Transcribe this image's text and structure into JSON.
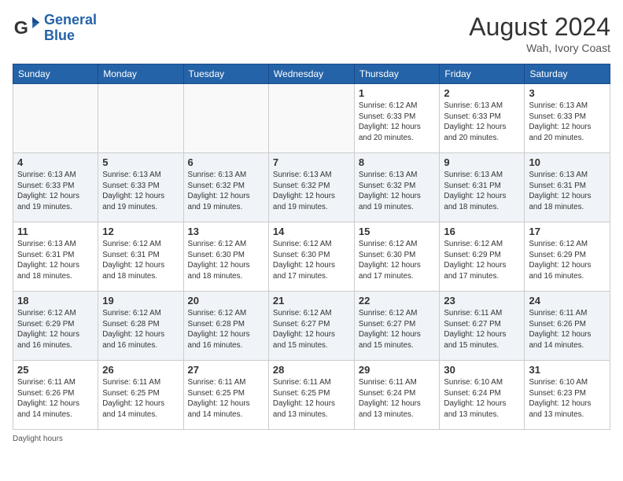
{
  "header": {
    "logo_line1": "General",
    "logo_line2": "Blue",
    "month_year": "August 2024",
    "location": "Wah, Ivory Coast"
  },
  "days_of_week": [
    "Sunday",
    "Monday",
    "Tuesday",
    "Wednesday",
    "Thursday",
    "Friday",
    "Saturday"
  ],
  "weeks": [
    [
      {
        "day": "",
        "info": ""
      },
      {
        "day": "",
        "info": ""
      },
      {
        "day": "",
        "info": ""
      },
      {
        "day": "",
        "info": ""
      },
      {
        "day": "1",
        "info": "Sunrise: 6:12 AM\nSunset: 6:33 PM\nDaylight: 12 hours\nand 20 minutes."
      },
      {
        "day": "2",
        "info": "Sunrise: 6:13 AM\nSunset: 6:33 PM\nDaylight: 12 hours\nand 20 minutes."
      },
      {
        "day": "3",
        "info": "Sunrise: 6:13 AM\nSunset: 6:33 PM\nDaylight: 12 hours\nand 20 minutes."
      }
    ],
    [
      {
        "day": "4",
        "info": "Sunrise: 6:13 AM\nSunset: 6:33 PM\nDaylight: 12 hours\nand 19 minutes."
      },
      {
        "day": "5",
        "info": "Sunrise: 6:13 AM\nSunset: 6:33 PM\nDaylight: 12 hours\nand 19 minutes."
      },
      {
        "day": "6",
        "info": "Sunrise: 6:13 AM\nSunset: 6:32 PM\nDaylight: 12 hours\nand 19 minutes."
      },
      {
        "day": "7",
        "info": "Sunrise: 6:13 AM\nSunset: 6:32 PM\nDaylight: 12 hours\nand 19 minutes."
      },
      {
        "day": "8",
        "info": "Sunrise: 6:13 AM\nSunset: 6:32 PM\nDaylight: 12 hours\nand 19 minutes."
      },
      {
        "day": "9",
        "info": "Sunrise: 6:13 AM\nSunset: 6:31 PM\nDaylight: 12 hours\nand 18 minutes."
      },
      {
        "day": "10",
        "info": "Sunrise: 6:13 AM\nSunset: 6:31 PM\nDaylight: 12 hours\nand 18 minutes."
      }
    ],
    [
      {
        "day": "11",
        "info": "Sunrise: 6:13 AM\nSunset: 6:31 PM\nDaylight: 12 hours\nand 18 minutes."
      },
      {
        "day": "12",
        "info": "Sunrise: 6:12 AM\nSunset: 6:31 PM\nDaylight: 12 hours\nand 18 minutes."
      },
      {
        "day": "13",
        "info": "Sunrise: 6:12 AM\nSunset: 6:30 PM\nDaylight: 12 hours\nand 18 minutes."
      },
      {
        "day": "14",
        "info": "Sunrise: 6:12 AM\nSunset: 6:30 PM\nDaylight: 12 hours\nand 17 minutes."
      },
      {
        "day": "15",
        "info": "Sunrise: 6:12 AM\nSunset: 6:30 PM\nDaylight: 12 hours\nand 17 minutes."
      },
      {
        "day": "16",
        "info": "Sunrise: 6:12 AM\nSunset: 6:29 PM\nDaylight: 12 hours\nand 17 minutes."
      },
      {
        "day": "17",
        "info": "Sunrise: 6:12 AM\nSunset: 6:29 PM\nDaylight: 12 hours\nand 16 minutes."
      }
    ],
    [
      {
        "day": "18",
        "info": "Sunrise: 6:12 AM\nSunset: 6:29 PM\nDaylight: 12 hours\nand 16 minutes."
      },
      {
        "day": "19",
        "info": "Sunrise: 6:12 AM\nSunset: 6:28 PM\nDaylight: 12 hours\nand 16 minutes."
      },
      {
        "day": "20",
        "info": "Sunrise: 6:12 AM\nSunset: 6:28 PM\nDaylight: 12 hours\nand 16 minutes."
      },
      {
        "day": "21",
        "info": "Sunrise: 6:12 AM\nSunset: 6:27 PM\nDaylight: 12 hours\nand 15 minutes."
      },
      {
        "day": "22",
        "info": "Sunrise: 6:12 AM\nSunset: 6:27 PM\nDaylight: 12 hours\nand 15 minutes."
      },
      {
        "day": "23",
        "info": "Sunrise: 6:11 AM\nSunset: 6:27 PM\nDaylight: 12 hours\nand 15 minutes."
      },
      {
        "day": "24",
        "info": "Sunrise: 6:11 AM\nSunset: 6:26 PM\nDaylight: 12 hours\nand 14 minutes."
      }
    ],
    [
      {
        "day": "25",
        "info": "Sunrise: 6:11 AM\nSunset: 6:26 PM\nDaylight: 12 hours\nand 14 minutes."
      },
      {
        "day": "26",
        "info": "Sunrise: 6:11 AM\nSunset: 6:25 PM\nDaylight: 12 hours\nand 14 minutes."
      },
      {
        "day": "27",
        "info": "Sunrise: 6:11 AM\nSunset: 6:25 PM\nDaylight: 12 hours\nand 14 minutes."
      },
      {
        "day": "28",
        "info": "Sunrise: 6:11 AM\nSunset: 6:25 PM\nDaylight: 12 hours\nand 13 minutes."
      },
      {
        "day": "29",
        "info": "Sunrise: 6:11 AM\nSunset: 6:24 PM\nDaylight: 12 hours\nand 13 minutes."
      },
      {
        "day": "30",
        "info": "Sunrise: 6:10 AM\nSunset: 6:24 PM\nDaylight: 12 hours\nand 13 minutes."
      },
      {
        "day": "31",
        "info": "Sunrise: 6:10 AM\nSunset: 6:23 PM\nDaylight: 12 hours\nand 13 minutes."
      }
    ]
  ],
  "footer": {
    "daylight_label": "Daylight hours"
  }
}
